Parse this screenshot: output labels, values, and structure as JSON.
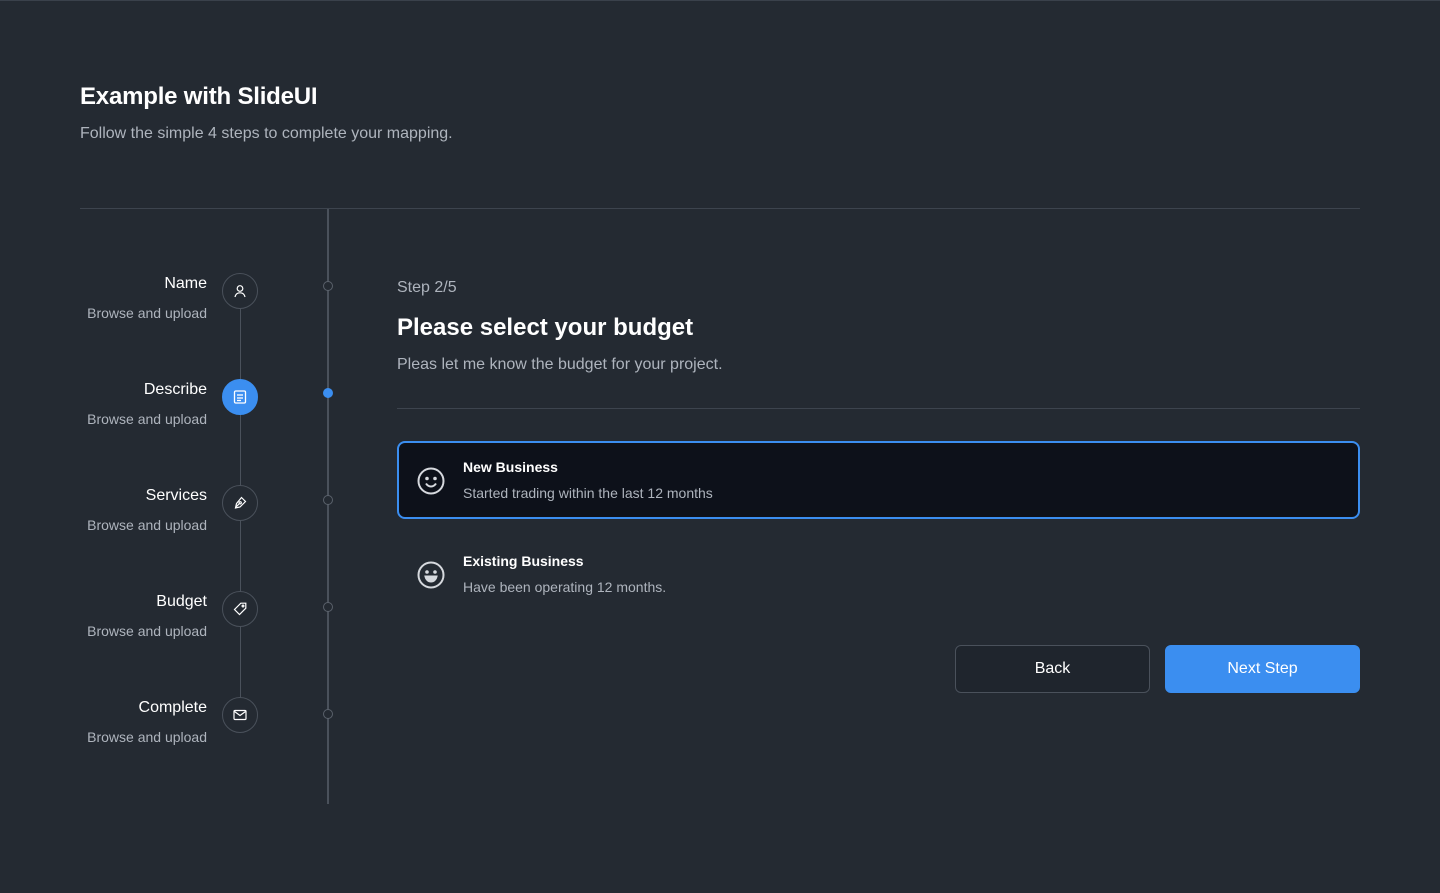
{
  "header": {
    "title": "Example with SlideUI",
    "subtitle": "Follow the simple 4 steps to complete your mapping."
  },
  "stepper": {
    "items": [
      {
        "label": "Name",
        "sub": "Browse and upload",
        "icon": "user-icon",
        "active": false
      },
      {
        "label": "Describe",
        "sub": "Browse and upload",
        "icon": "document-icon",
        "active": true
      },
      {
        "label": "Services",
        "sub": "Browse and upload",
        "icon": "pen-icon",
        "active": false
      },
      {
        "label": "Budget",
        "sub": "Browse and upload",
        "icon": "tag-icon",
        "active": false
      },
      {
        "label": "Complete",
        "sub": "Browse and upload",
        "icon": "mail-icon",
        "active": false
      }
    ]
  },
  "main": {
    "step_count": "Step 2/5",
    "title": "Please select your budget",
    "description": "Pleas let me know the budget for your project.",
    "options": [
      {
        "title": "New Business",
        "sub": "Started trading within the last 12 months",
        "selected": true,
        "icon": "smile-icon"
      },
      {
        "title": "Existing Business",
        "sub": "Have been operating 12 months.",
        "selected": false,
        "icon": "grin-icon"
      }
    ],
    "back_label": "Back",
    "next_label": "Next Step"
  },
  "colors": {
    "background": "#242a32",
    "accent": "#3b8ef0",
    "selected_bg": "#0d111a",
    "muted_text": "#aeb4bd"
  }
}
